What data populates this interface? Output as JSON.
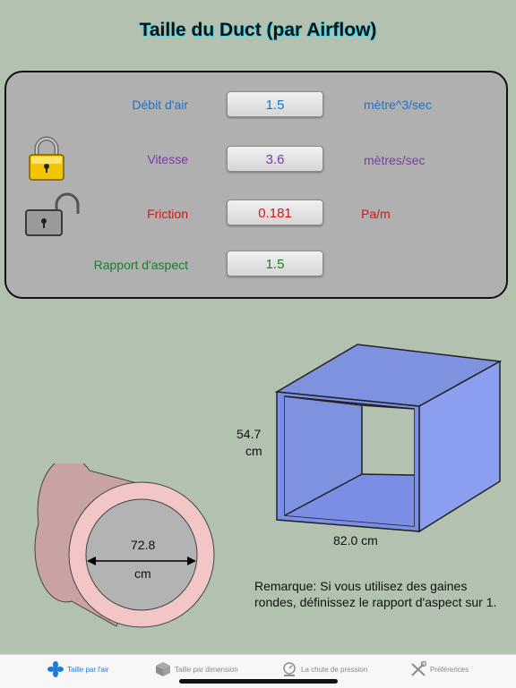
{
  "title": "Taille du Duct (par Airflow)",
  "inputs": [
    {
      "label": "Débit d'air",
      "value": "1.5",
      "unit": "mètre^3/sec",
      "color": "#1a73d1"
    },
    {
      "label": "Vitesse",
      "value": "3.6",
      "unit": "mètres/sec",
      "color": "#7a3aa8"
    },
    {
      "label": "Friction",
      "value": "0.181",
      "unit": "Pa/m",
      "color": "#e01010"
    },
    {
      "label": "Rapport d'aspect",
      "value": "1.5",
      "unit": "",
      "color": "#1e7a2e"
    }
  ],
  "locks": {
    "velocity": "locked-icon",
    "friction": "unlocked-icon"
  },
  "rect_duct": {
    "height_value": "54.7",
    "height_unit": "cm",
    "width_label": "82.0 cm"
  },
  "round_duct": {
    "diameter_value": "72.8",
    "diameter_unit": "cm"
  },
  "note": "Remarque: Si vous utilisez des gaines rondes, définissez le rapport d'aspect sur 1.",
  "tabs": [
    {
      "label": "Taille par l'air",
      "icon": "fan-icon",
      "active": true
    },
    {
      "label": "Taille par dimension",
      "icon": "cube-icon",
      "active": false
    },
    {
      "label": "La chute de pression",
      "icon": "gauge-icon",
      "active": false
    },
    {
      "label": "Préférences",
      "icon": "tools-icon",
      "active": false
    }
  ],
  "colors": {
    "background": "#b3c1b0",
    "panel": "#b0b0b0",
    "accent": "#1e7bd6",
    "duct_blue": "#8b9ee8",
    "round_duct": "#c9a3a3"
  }
}
